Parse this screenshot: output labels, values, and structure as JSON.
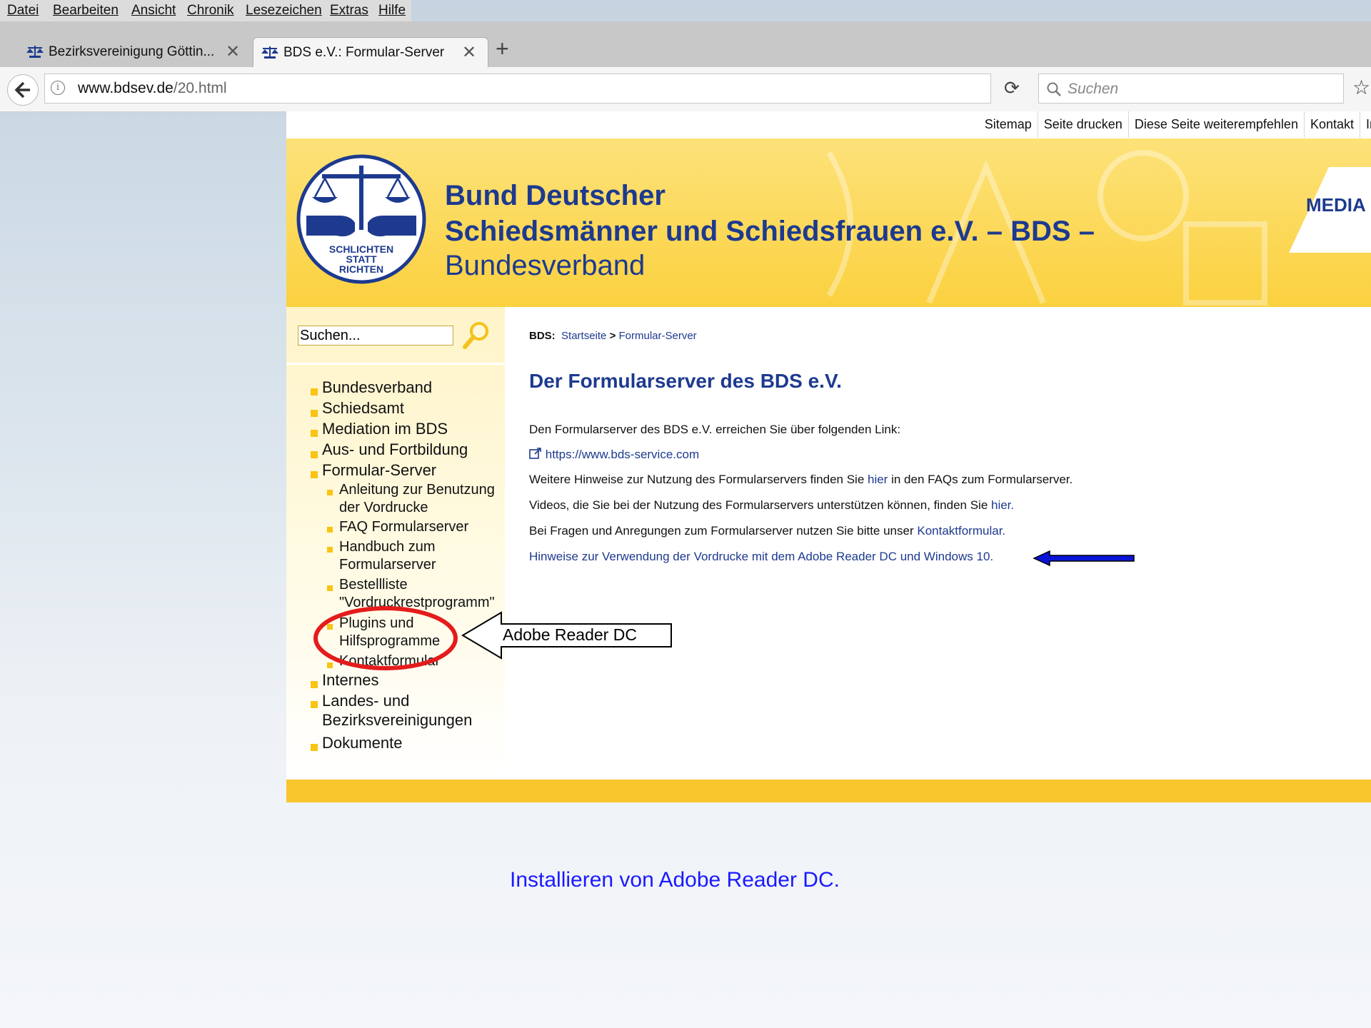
{
  "browser": {
    "menu": [
      "Datei",
      "Bearbeiten",
      "Ansicht",
      "Chronik",
      "Lesezeichen",
      "Extras",
      "Hilfe"
    ],
    "tabs": [
      {
        "title": "Bezirksvereinigung Göttin...",
        "active": false
      },
      {
        "title": "BDS e.V.: Formular-Server",
        "active": true
      }
    ],
    "new_tab_glyph": "+",
    "url_host": "www.bdsev.de",
    "url_path": "/20.html",
    "search_placeholder": "Suchen",
    "icons": [
      "back-arrow-icon",
      "info-icon",
      "reload-icon",
      "search-icon",
      "bookmark-star-icon",
      "close-icon",
      "favicon-scales-icon"
    ]
  },
  "site": {
    "top_links": [
      "Sitemap",
      "Seite drucken",
      "Diese Seite weiterempfehlen",
      "Kontakt",
      "Ir"
    ],
    "header": {
      "line1": "Bund Deutscher",
      "line2": "Schiedsmänner und Schiedsfrauen e.V. – BDS –",
      "line3": "Bundesverband",
      "media_label": "MEDIA",
      "logo_text": [
        "SCHLICHTEN",
        "STATT",
        "RICHTEN"
      ]
    },
    "sidebar": {
      "search_value": "Suchen...",
      "nav": [
        {
          "label": "Bundesverband",
          "level": 1
        },
        {
          "label": "Schiedsamt",
          "level": 1
        },
        {
          "label": "Mediation im BDS",
          "level": 1
        },
        {
          "label": "Aus- und Fortbildung",
          "level": 1
        },
        {
          "label": "Formular-Server",
          "level": 1
        },
        {
          "label": "Anleitung zur Benutzung",
          "label2": "der Vordrucke",
          "level": 2
        },
        {
          "label": "FAQ Formularserver",
          "level": 2
        },
        {
          "label": "Handbuch zum",
          "label2": "Formularserver",
          "level": 2
        },
        {
          "label": "Bestellliste",
          "label2": "\"Vordruckrestprogramm\"",
          "level": 2
        },
        {
          "label": "Plugins und",
          "label2": "Hilfsprogramme",
          "level": 2
        },
        {
          "label": "Kontaktformular",
          "level": 2
        },
        {
          "label": "Internes",
          "level": 1
        },
        {
          "label": "Landes- und",
          "label2": "Bezirksvereinigungen",
          "level": 1
        },
        {
          "label": "Dokumente",
          "level": 1
        }
      ]
    },
    "breadcrumb": {
      "prefix": "BDS:",
      "home": "Startseite",
      "sep": ">",
      "current": "Formular-Server"
    },
    "title": "Der Formularserver des BDS e.V.",
    "paragraphs": {
      "p1": "Den Formularserver des BDS e.V. erreichen Sie über folgenden Link:",
      "link": "https://www.bds-service.com",
      "p2a": "Weitere Hinweise zur Nutzung des Formularservers finden Sie ",
      "p2link": "hier",
      "p2b": " in den FAQs zum Formularserver.",
      "p3a": "Videos, die Sie bei der Nutzung des Formularservers unterstützen können, finden Sie ",
      "p3link": "hier.",
      "p4a": "Bei Fragen und Anregungen zum Formularserver nutzen Sie bitte unser ",
      "p4link": "Kontaktformular.",
      "p5": "Hinweise zur Verwendung der Vordrucke mit dem Adobe Reader DC und Windows 10."
    }
  },
  "annotations": {
    "callout_text": "Adobe Reader DC",
    "caption": "Installieren von Adobe Reader DC.",
    "highlight_color": "#e41c1c",
    "arrow_color": "#0a14d8"
  }
}
